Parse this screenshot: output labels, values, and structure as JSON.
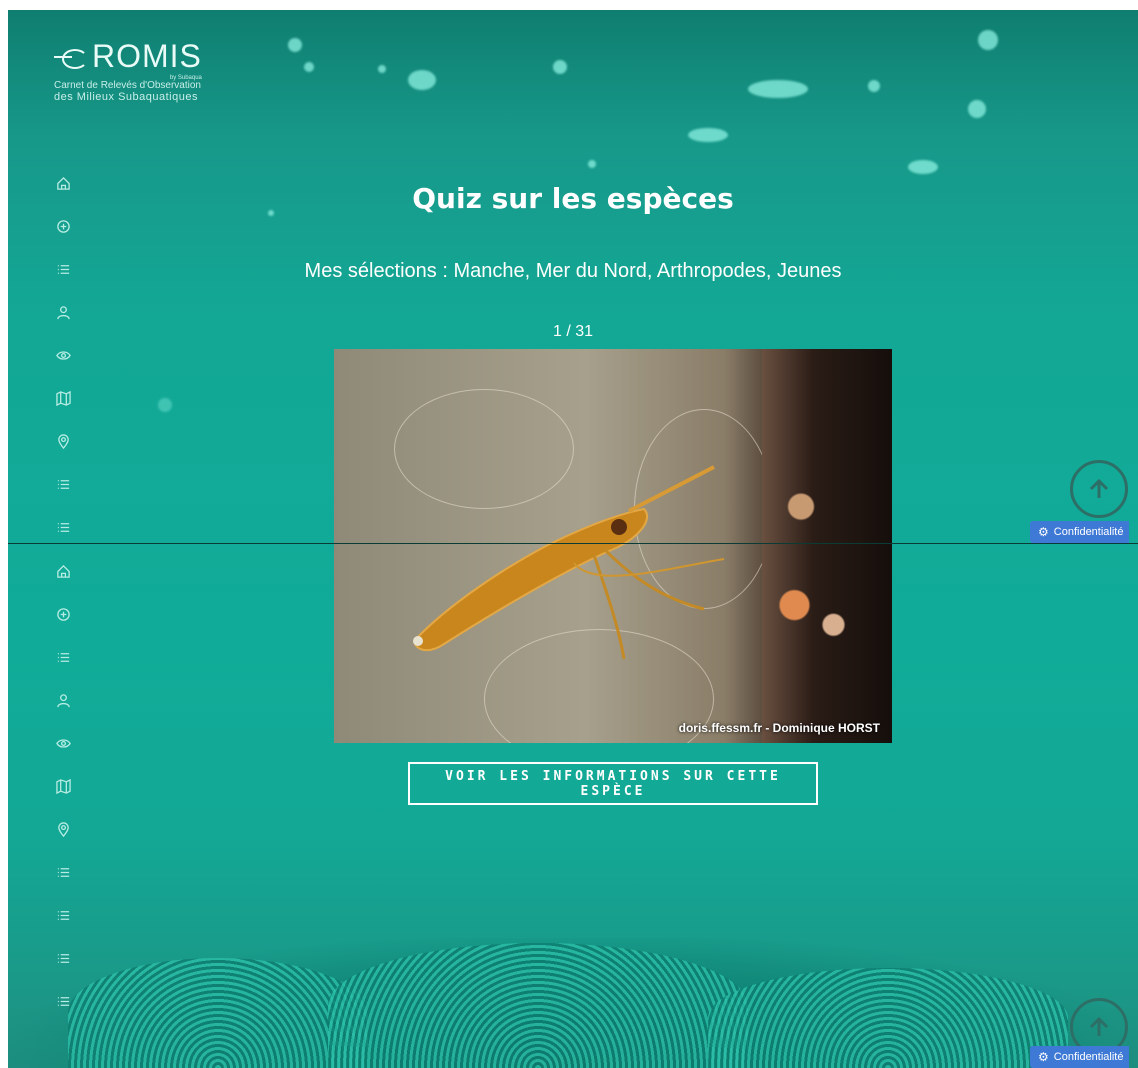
{
  "logo": {
    "brand": "ROMIS",
    "tag": "by Subaqua",
    "line1": "Carnet de Relevés d'Observation",
    "line2": "des Milieux Subaquatiques"
  },
  "sidebar_top": [
    {
      "icon": "home-icon"
    },
    {
      "icon": "add-circle-icon"
    },
    {
      "icon": "list-icon"
    },
    {
      "icon": "user-icon"
    },
    {
      "icon": "eye-icon"
    },
    {
      "icon": "map-icon"
    },
    {
      "icon": "location-pin-icon"
    },
    {
      "icon": "list-icon"
    },
    {
      "icon": "list-icon"
    }
  ],
  "sidebar_bottom": [
    {
      "icon": "home-icon"
    },
    {
      "icon": "add-circle-icon"
    },
    {
      "icon": "list-icon"
    },
    {
      "icon": "user-icon"
    },
    {
      "icon": "eye-icon"
    },
    {
      "icon": "map-icon"
    },
    {
      "icon": "location-pin-icon"
    },
    {
      "icon": "list-icon"
    },
    {
      "icon": "list-icon"
    },
    {
      "icon": "list-icon"
    },
    {
      "icon": "list-icon"
    }
  ],
  "main": {
    "title": "Quiz sur les espèces",
    "selections": "Mes sélections : Manche, Mer du Nord, Arthropodes, Jeunes",
    "counter": "1 / 31",
    "photo_credit": "doris.ffessm.fr - Dominique HORST",
    "info_button": "VOIR LES INFORMATIONS SUR CETTE ESPÈCE"
  },
  "privacy_label": "Confidentialité",
  "colors": {
    "background": "#12a997",
    "privacy_button": "#3f79d6",
    "scroll_top_ring": "#2d6f66"
  }
}
